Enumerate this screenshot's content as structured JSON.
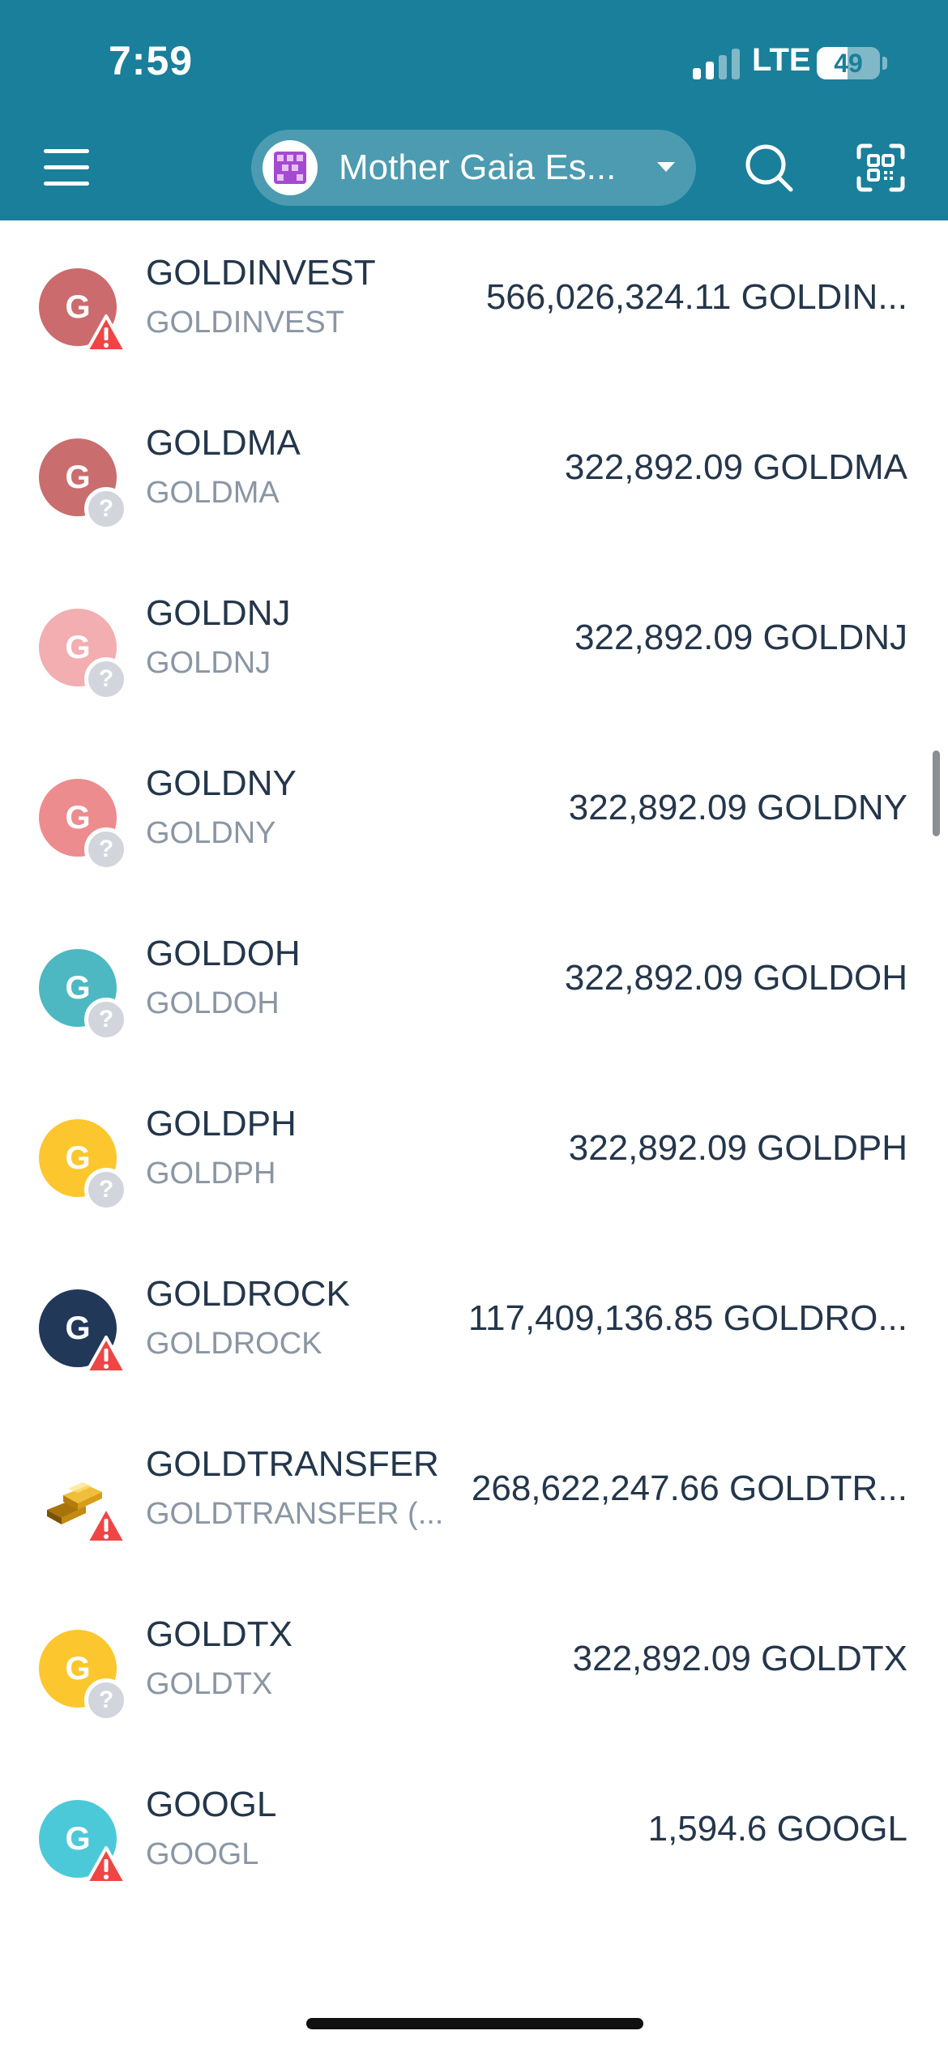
{
  "status_bar": {
    "time": "7:59",
    "network": "LTE",
    "battery": "49",
    "battery_level": 0.49
  },
  "header": {
    "account_name": "Mother Gaia Es...",
    "accent_color": "#1a7f9a"
  },
  "tokens": [
    {
      "name": "GOLDINVEST",
      "symbol": "GOLDINVEST",
      "balance": "566,026,324.11 GOLDIN...",
      "icon_letter": "G",
      "icon_color": "#cc6b6e",
      "badge": "warning"
    },
    {
      "name": "GOLDMA",
      "symbol": "GOLDMA",
      "balance": "322,892.09 GOLDMA",
      "icon_letter": "G",
      "icon_color": "#c96d6f",
      "badge": "unknown"
    },
    {
      "name": "GOLDNJ",
      "symbol": "GOLDNJ",
      "balance": "322,892.09 GOLDNJ",
      "icon_letter": "G",
      "icon_color": "#f2aeb0",
      "badge": "unknown"
    },
    {
      "name": "GOLDNY",
      "symbol": "GOLDNY",
      "balance": "322,892.09 GOLDNY",
      "icon_letter": "G",
      "icon_color": "#ec8c8e",
      "badge": "unknown"
    },
    {
      "name": "GOLDOH",
      "symbol": "GOLDOH",
      "balance": "322,892.09 GOLDOH",
      "icon_letter": "G",
      "icon_color": "#4db8c1",
      "badge": "unknown"
    },
    {
      "name": "GOLDPH",
      "symbol": "GOLDPH",
      "balance": "322,892.09 GOLDPH",
      "icon_letter": "G",
      "icon_color": "#fcc72e",
      "badge": "unknown"
    },
    {
      "name": "GOLDROCK",
      "symbol": "GOLDROCK",
      "balance": "117,409,136.85 GOLDRO...",
      "icon_letter": "G",
      "icon_color": "#213858",
      "badge": "warning"
    },
    {
      "name": "GOLDTRANSFER",
      "symbol": "GOLDTRANSFER (...",
      "balance": "268,622,247.66 GOLDTR...",
      "icon_letter": "",
      "icon_color": "#ffffff",
      "icon_type": "gold-bars",
      "badge": "warning"
    },
    {
      "name": "GOLDTX",
      "symbol": "GOLDTX",
      "balance": "322,892.09 GOLDTX",
      "icon_letter": "G",
      "icon_color": "#fcc72e",
      "badge": "unknown"
    },
    {
      "name": "GOOGL",
      "symbol": "GOOGL",
      "balance": "1,594.6 GOOGL",
      "icon_letter": "G",
      "icon_color": "#4cc9d8",
      "badge": "warning"
    }
  ]
}
